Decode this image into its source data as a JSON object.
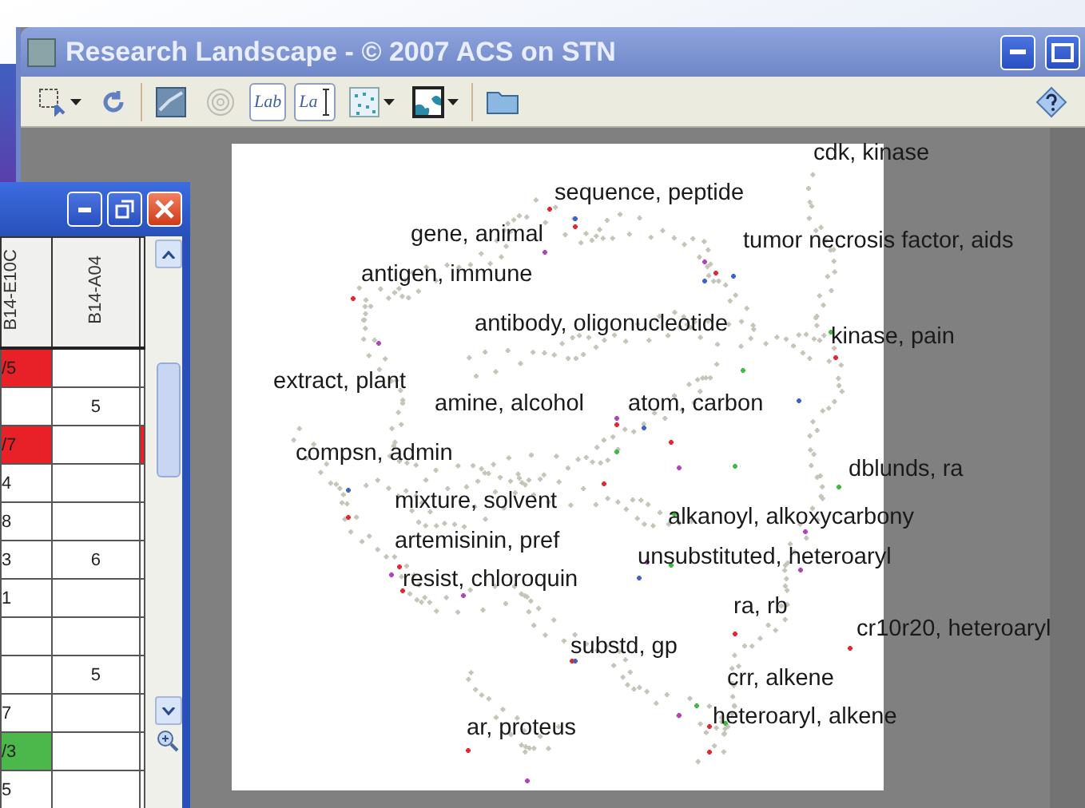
{
  "main_window": {
    "title": "Research Landscape - © 2007 ACS on STN",
    "toolbar": [
      {
        "kind": "select",
        "dropdown": true,
        "pressed": false,
        "disabled": false
      },
      {
        "kind": "refresh",
        "dropdown": false,
        "pressed": false,
        "disabled": false
      },
      {
        "kind": "separator"
      },
      {
        "kind": "map",
        "dropdown": false,
        "pressed": false,
        "disabled": false
      },
      {
        "kind": "contour",
        "dropdown": false,
        "pressed": false,
        "disabled": true
      },
      {
        "kind": "labels",
        "text": "Lab",
        "dropdown": false,
        "pressed": true,
        "disabled": false
      },
      {
        "kind": "label-edit",
        "text": "La",
        "dropdown": false,
        "pressed": true,
        "disabled": false
      },
      {
        "kind": "points",
        "dropdown": true,
        "pressed": false,
        "disabled": false
      },
      {
        "kind": "color-map",
        "dropdown": true,
        "pressed": false,
        "disabled": false
      },
      {
        "kind": "separator"
      },
      {
        "kind": "folder",
        "dropdown": false,
        "pressed": false,
        "disabled": false
      },
      {
        "kind": "help",
        "dropdown": false,
        "pressed": false,
        "disabled": false
      }
    ],
    "map": {
      "labels": [
        "cdk, kinase",
        "sequence, peptide",
        "gene, animal",
        "tumor necrosis factor, aids",
        "antigen, immune",
        "antibody, oligonucleotide",
        "kinase, pain",
        "extract, plant",
        "amine, alcohol",
        "atom, carbon",
        "compsn, admin",
        "dblunds, ra",
        "mixture, solvent",
        "alkanoyl, alkoxycarbony",
        "artemisinin, pref",
        "unsubstituted, heteroaryl",
        "resist, chloroquin",
        "ra, rb",
        "cr10r20, heteroaryl",
        "substd, gp",
        "crr, alkene",
        "heteroaryl, alkene",
        "ar, proteus"
      ]
    }
  },
  "table_window": {
    "columns": [
      "B14-E10C",
      "B14-A04"
    ],
    "rows": [
      {
        "cells": [
          {
            "text": "/5",
            "color": "#e82028"
          },
          {},
          {}
        ]
      },
      {
        "cells": [
          {},
          {
            "text": "5"
          },
          {}
        ]
      },
      {
        "cells": [
          {
            "text": "/7",
            "color": "#e82028"
          },
          {},
          {
            "color": "#e82028"
          }
        ]
      },
      {
        "cells": [
          {
            "text": "4"
          },
          {},
          {}
        ]
      },
      {
        "cells": [
          {
            "text": "8"
          },
          {},
          {}
        ]
      },
      {
        "cells": [
          {
            "text": "3"
          },
          {
            "text": "6"
          },
          {}
        ]
      },
      {
        "cells": [
          {
            "text": "1"
          },
          {},
          {}
        ]
      },
      {
        "cells": [
          {},
          {},
          {}
        ]
      },
      {
        "cells": [
          {},
          {
            "text": "5"
          },
          {}
        ]
      },
      {
        "cells": [
          {
            "text": "7"
          },
          {},
          {}
        ]
      },
      {
        "cells": [
          {
            "text": "/3",
            "color": "#4cb84c"
          },
          {},
          {}
        ]
      },
      {
        "cells": [
          {
            "text": "5"
          },
          {},
          {}
        ]
      }
    ]
  }
}
